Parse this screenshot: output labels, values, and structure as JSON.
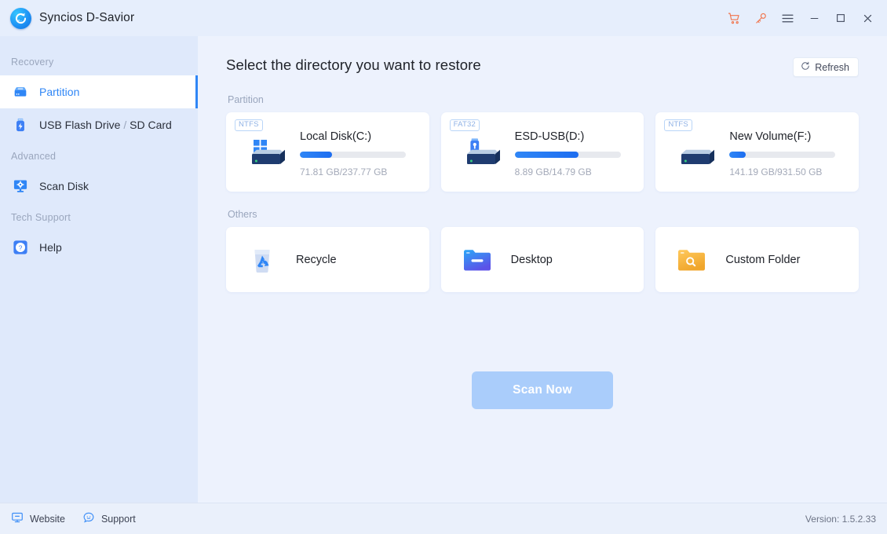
{
  "window": {
    "app_title": "Syncios D-Savior",
    "logo_icon": "recovery-circle-logo",
    "controls": [
      {
        "name": "cart-icon",
        "label": "Cart"
      },
      {
        "name": "key-icon",
        "label": "Register"
      },
      {
        "name": "menu-icon",
        "label": "Menu"
      },
      {
        "name": "minimize-icon",
        "label": "Minimize"
      },
      {
        "name": "maximize-icon",
        "label": "Maximize"
      },
      {
        "name": "close-icon",
        "label": "Close"
      }
    ]
  },
  "sidebar": {
    "groups": [
      {
        "label": "Recovery"
      },
      {
        "label": "Advanced"
      },
      {
        "label": "Tech Support"
      }
    ],
    "items": [
      {
        "label": "Partition",
        "icon": "partition-drive-icon",
        "active": true
      },
      {
        "label": "USB Flash Drive / SD Card",
        "icon": "usb-flash-icon",
        "active": false
      },
      {
        "label": "Scan Disk",
        "icon": "scan-disk-monitor-icon",
        "active": false
      },
      {
        "label": "Help",
        "icon": "help-question-icon",
        "active": false
      }
    ]
  },
  "main": {
    "title": "Select the directory you want to restore",
    "refresh_label": "Refresh",
    "refresh_icon": "refresh-icon",
    "partition_section_label": "Partition",
    "others_section_label": "Others",
    "partitions": [
      {
        "fs": "NTFS",
        "name": "Local Disk(C:)",
        "size": "71.81 GB/237.77 GB",
        "used_percent": 30,
        "icon": "windows-drive-icon"
      },
      {
        "fs": "FAT32",
        "name": "ESD-USB(D:)",
        "size": "8.89 GB/14.79 GB",
        "used_percent": 60,
        "icon": "usb-drive-icon"
      },
      {
        "fs": "NTFS",
        "name": "New Volume(F:)",
        "size": "141.19 GB/931.50 GB",
        "used_percent": 15,
        "icon": "plain-drive-icon"
      }
    ],
    "others": [
      {
        "label": "Recycle",
        "icon": "recycle-bin-icon"
      },
      {
        "label": "Desktop",
        "icon": "blue-folder-icon"
      },
      {
        "label": "Custom Folder",
        "icon": "orange-search-folder-icon"
      }
    ],
    "scan_button": "Scan Now"
  },
  "footer": {
    "website_label": "Website",
    "website_icon": "monitor-icon",
    "support_label": "Support",
    "support_icon": "chat-bubble-icon",
    "version": "Version: 1.5.2.33"
  },
  "colors": {
    "accent": "#2f86f6",
    "accent_orange": "#f1734a",
    "sidebar_bg": "#dfe9fb",
    "main_bg": "#edf2fd",
    "card_bg": "#ffffff",
    "muted_text": "#9aa6bd",
    "scan_disabled": "#aacdfb"
  }
}
